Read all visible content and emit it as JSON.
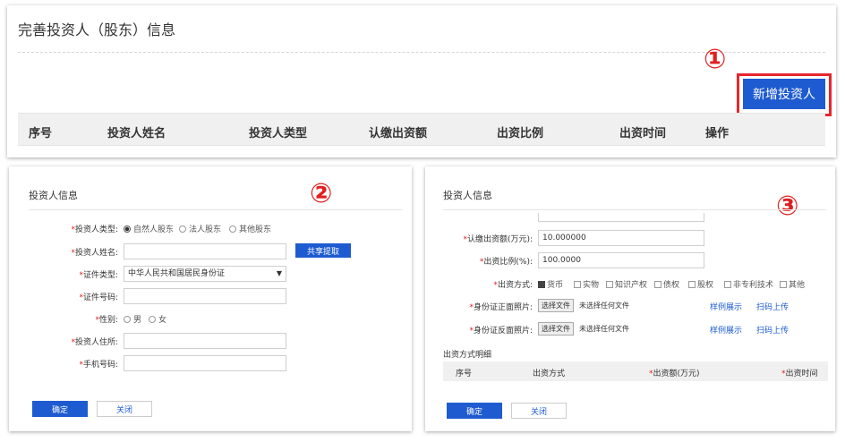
{
  "panel1": {
    "title": "完善投资人（股东）信息",
    "marker": "①",
    "add_button": "新增投资人",
    "columns": [
      "序号",
      "投资人姓名",
      "投资人类型",
      "认缴出资额",
      "出资比例",
      "出资时间",
      "操作"
    ]
  },
  "panel2": {
    "section_title": "投资人信息",
    "marker": "②",
    "investor_type": {
      "label": "投资人类型:",
      "options": [
        "自然人股东",
        "法人股东",
        "其他股东"
      ],
      "selected": "自然人股东"
    },
    "name": {
      "label": "投资人姓名:",
      "value": "",
      "share_button": "共享提取"
    },
    "cert_type": {
      "label": "证件类型:",
      "value": "中华人民共和国居民身份证"
    },
    "cert_number": {
      "label": "证件号码:",
      "value": ""
    },
    "gender": {
      "label": "性别:",
      "options": [
        "男",
        "女"
      ]
    },
    "address": {
      "label": "投资人住所:",
      "value": ""
    },
    "phone": {
      "label": "手机号码:",
      "value": ""
    },
    "confirm_button": "确定",
    "close_button": "关闭"
  },
  "panel3": {
    "section_title": "投资人信息",
    "marker": "③",
    "subscribed_amount": {
      "label": "认缴出资额(万元):",
      "value": "10.000000"
    },
    "ratio": {
      "label": "出资比例(%):",
      "value": "100.0000"
    },
    "method": {
      "label": "出资方式:",
      "options": [
        "货币",
        "实物",
        "知识产权",
        "债权",
        "股权",
        "非专利技术",
        "其他"
      ],
      "checked": "货币"
    },
    "id_front": {
      "label": "身份证正面照片:",
      "file_button": "选择文件",
      "file_text": "未选择任何文件",
      "sample_link": "样例展示",
      "scan_link": "扫码上传"
    },
    "id_back": {
      "label": "身份证反面照片:",
      "file_button": "选择文件",
      "file_text": "未选择任何文件",
      "sample_link": "样例展示",
      "scan_link": "扫码上传"
    },
    "detail_title": "出资方式明细",
    "detail_columns": [
      "序号",
      "出资方式",
      "出资额(万元)",
      "出资时间"
    ],
    "confirm_button": "确定",
    "close_button": "关闭"
  }
}
